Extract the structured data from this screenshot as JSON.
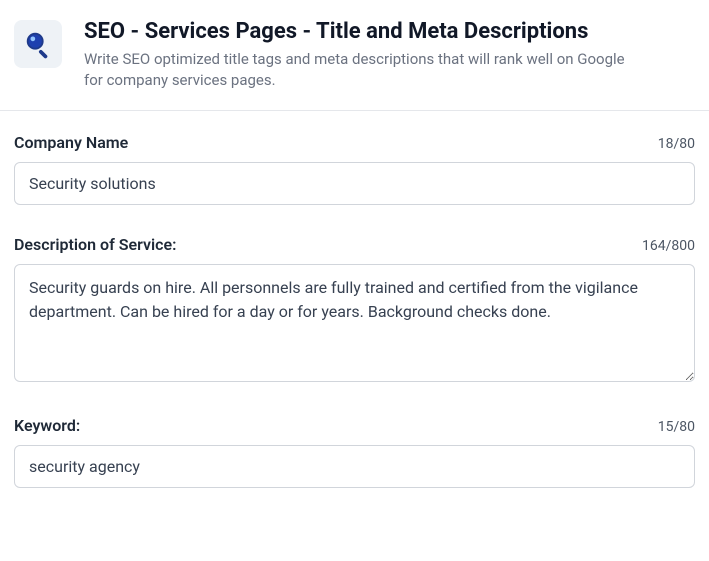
{
  "header": {
    "title": "SEO - Services Pages - Title and Meta Descriptions",
    "subtitle": "Write SEO optimized title tags and meta descriptions that will rank well on Google for company services pages."
  },
  "fields": {
    "companyName": {
      "label": "Company Name",
      "counter": "18/80",
      "value": "Security solutions"
    },
    "description": {
      "label": "Description of Service:",
      "counter": "164/800",
      "value": "Security guards on hire. All personnels are fully trained and certified from the vigilance department. Can be hired for a day or for years. Background checks done."
    },
    "keyword": {
      "label": "Keyword:",
      "counter": "15/80",
      "value": "security agency"
    }
  }
}
